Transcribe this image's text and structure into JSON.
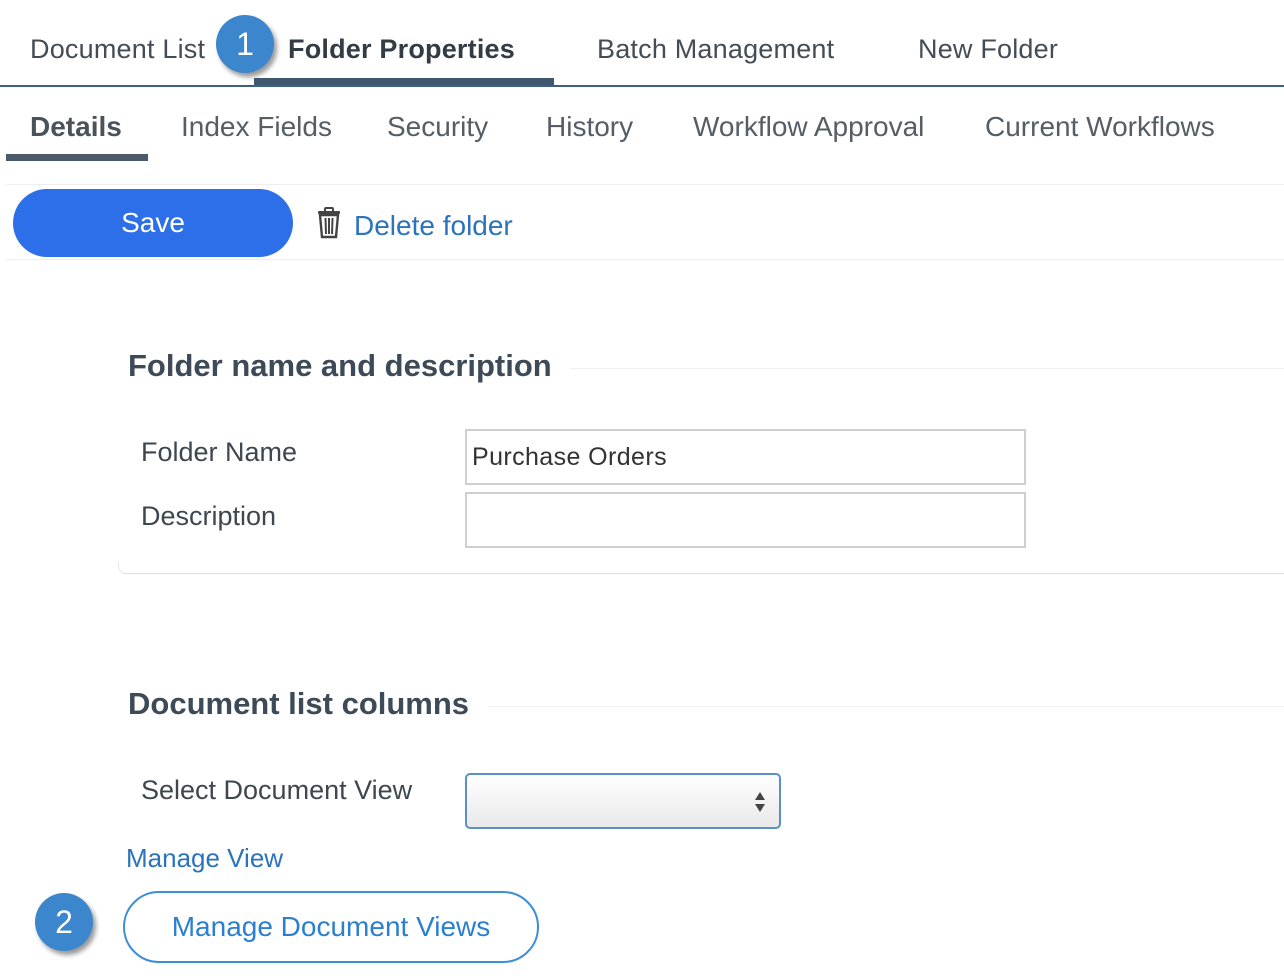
{
  "top_tabs": [
    {
      "label": "Document List"
    },
    {
      "label": "Folder Properties"
    },
    {
      "label": "Batch Management"
    },
    {
      "label": "New Folder"
    }
  ],
  "sub_tabs": [
    {
      "label": "Details"
    },
    {
      "label": "Index Fields"
    },
    {
      "label": "Security"
    },
    {
      "label": "History"
    },
    {
      "label": "Workflow Approval"
    },
    {
      "label": "Current Workflows"
    }
  ],
  "toolbar": {
    "save_label": "Save",
    "delete_label": "Delete folder"
  },
  "badges": {
    "one": "1",
    "two": "2"
  },
  "folder_section": {
    "title": "Folder name and description",
    "name_label": "Folder Name",
    "name_value": "Purchase Orders",
    "description_label": "Description",
    "description_value": ""
  },
  "columns_section": {
    "title": "Document list columns",
    "view_label": "Select Document View",
    "view_selected": "",
    "manage_view_link": "Manage View",
    "manage_views_button": "Manage Document Views"
  },
  "colors": {
    "accent": "#2d6fe9",
    "link": "#2b73bb",
    "badge": "#3b86cc"
  }
}
